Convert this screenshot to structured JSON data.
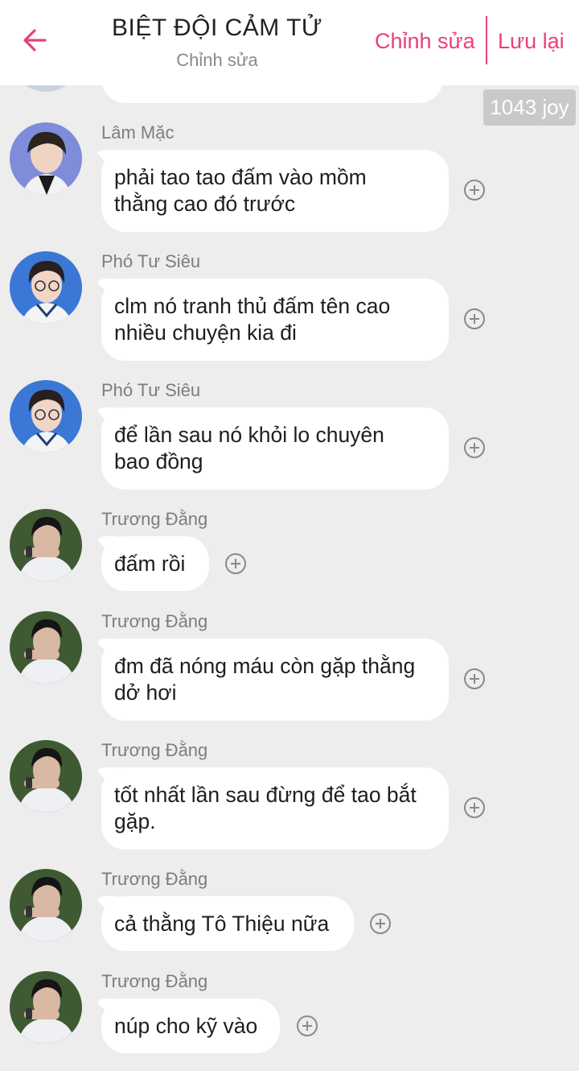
{
  "header": {
    "title": "BIỆT ĐỘI CẢM TỬ",
    "subtitle": "Chỉnh sửa",
    "edit_label": "Chỉnh sửa",
    "save_label": "Lưu lại",
    "back_icon": "arrow-left-icon"
  },
  "joy_badge": "1043 joy",
  "colors": {
    "accent": "#e8407e",
    "background": "#ededed",
    "bubble": "#ffffff",
    "sender_text": "#7d7d7d"
  },
  "messages": [
    {
      "sender": "Lâm Mặc",
      "lines": [
        "phải tao tao đấm vào mồm",
        "thằng cao đó trước"
      ]
    },
    {
      "sender": "Phó Tư Siêu",
      "lines": [
        "clm nó tranh thủ đấm tên cao",
        "nhiều chuyện kia đi"
      ]
    },
    {
      "sender": "Phó Tư Siêu",
      "lines": [
        "để lần sau nó khỏi lo chuyên",
        "bao đồng"
      ]
    },
    {
      "sender": "Trương Đằng",
      "lines": [
        "đấm rồi"
      ]
    },
    {
      "sender": "Trương Đằng",
      "lines": [
        "đm đã nóng máu còn gặp thằng",
        "dở hơi"
      ]
    },
    {
      "sender": "Trương Đằng",
      "lines": [
        "tốt nhất lần sau đừng để tao bắt",
        "gặp."
      ]
    },
    {
      "sender": "Trương Đằng",
      "lines": [
        "cả thằng Tô Thiệu nữa"
      ]
    },
    {
      "sender": "Trương Đằng",
      "lines": [
        "núp cho kỹ vào"
      ]
    }
  ]
}
